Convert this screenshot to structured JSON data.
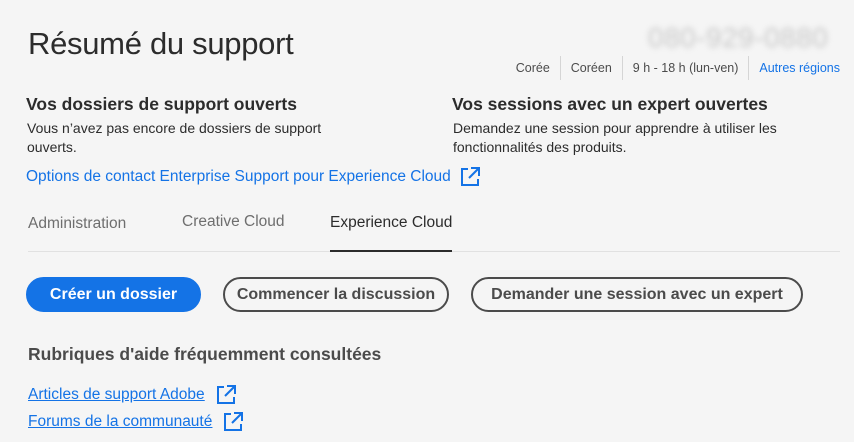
{
  "header": {
    "title": "Résumé du support",
    "phone": "080-929-0880"
  },
  "region_bar": {
    "country": "Corée",
    "language": "Coréen",
    "hours": "9 h - 18 h (lun-ven)",
    "other_regions": "Autres régions"
  },
  "open_cases": {
    "heading": "Vos dossiers de support ouverts",
    "text": "Vous n’avez pas encore de dossiers de support ouverts."
  },
  "expert_sessions": {
    "heading": "Vos sessions avec un expert ouvertes",
    "text": "Demandez une session pour apprendre à utiliser les fonctionnalités des produits."
  },
  "enterprise_link": "Options de contact Enterprise Support pour Experience Cloud",
  "tabs": [
    {
      "label": "Administration",
      "active": false
    },
    {
      "label": "Creative Cloud",
      "active": false
    },
    {
      "label": "Experience Cloud",
      "active": true
    }
  ],
  "actions": {
    "create_case": "Créer un dossier",
    "start_chat": "Commencer la discussion",
    "request_session": "Demander une session avec un expert"
  },
  "help": {
    "heading": "Rubriques d'aide fréquemment consultées",
    "links": [
      {
        "label": "Articles de support Adobe"
      },
      {
        "label": "Forums de la communauté"
      }
    ]
  },
  "colors": {
    "accent": "#1473e6",
    "text": "#2c2c2c",
    "background": "#f5f5f5"
  },
  "icons": {
    "external_link": "external-link-icon"
  }
}
